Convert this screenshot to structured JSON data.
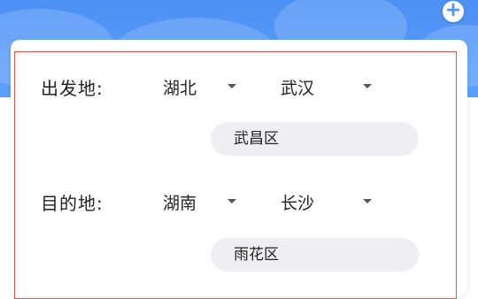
{
  "header": {
    "add_icon_glyph": "+"
  },
  "departure": {
    "label": "出发地:",
    "province": "湖北",
    "city": "武汉",
    "district": "武昌区"
  },
  "destination": {
    "label": "目的地:",
    "province": "湖南",
    "city": "长沙",
    "district": "雨花区"
  },
  "colors": {
    "header_blue": "#4d90f5",
    "frame_red": "#e0564b",
    "district_bg": "#efeff3"
  }
}
